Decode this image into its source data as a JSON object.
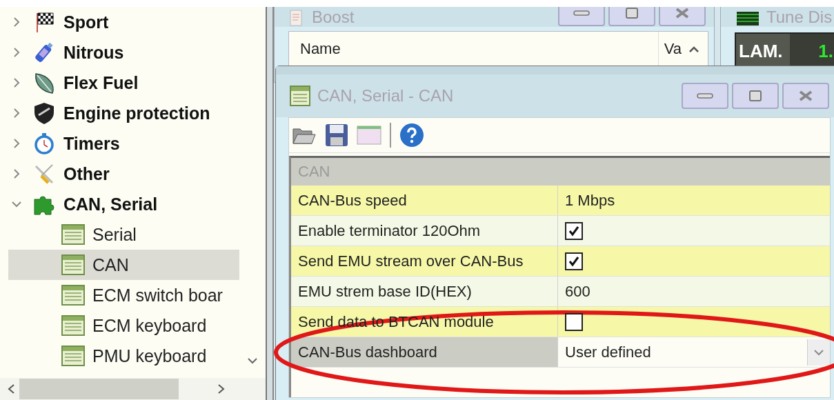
{
  "tree": [
    {
      "label": "Sport",
      "expanded": false,
      "selected": false
    },
    {
      "label": "Nitrous",
      "expanded": false,
      "selected": false
    },
    {
      "label": "Flex Fuel",
      "expanded": false,
      "selected": false
    },
    {
      "label": "Engine protection",
      "expanded": false,
      "selected": false
    },
    {
      "label": "Timers",
      "expanded": false,
      "selected": false
    },
    {
      "label": "Other",
      "expanded": false,
      "selected": false
    },
    {
      "label": "CAN, Serial",
      "expanded": true,
      "selected": false,
      "children": [
        {
          "label": "Serial",
          "selected": false
        },
        {
          "label": "CAN",
          "selected": true
        },
        {
          "label": "ECM switch boar",
          "selected": false
        },
        {
          "label": "ECM keyboard",
          "selected": false
        },
        {
          "label": "PMU keyboard",
          "selected": false
        }
      ]
    }
  ],
  "boost_window": {
    "title": "Boost",
    "columns": [
      "Name",
      "Va"
    ]
  },
  "tune_window": {
    "title": "Tune Dis",
    "cells": [
      {
        "label": "LAM.",
        "value": "1."
      }
    ]
  },
  "dialog": {
    "title": "CAN, Serial - CAN",
    "section": "CAN",
    "rows": [
      {
        "label": "CAN-Bus speed",
        "kind": "text",
        "value": "1 Mbps",
        "selected": false,
        "annotated": false
      },
      {
        "label": "Enable terminator 120Ohm",
        "kind": "checkbox",
        "checked": true,
        "selected": false,
        "annotated": false
      },
      {
        "label": "Send EMU stream over CAN-Bus",
        "kind": "checkbox",
        "checked": true,
        "selected": false,
        "annotated": false
      },
      {
        "label": "EMU strem base ID(HEX)",
        "kind": "text",
        "value": "600",
        "selected": false,
        "annotated": false
      },
      {
        "label": "Send data to BTCAN module",
        "kind": "checkbox",
        "checked": false,
        "selected": false,
        "annotated": false
      },
      {
        "label": "CAN-Bus dashboard",
        "kind": "select",
        "value": "User defined",
        "selected": true,
        "annotated": true
      }
    ]
  }
}
